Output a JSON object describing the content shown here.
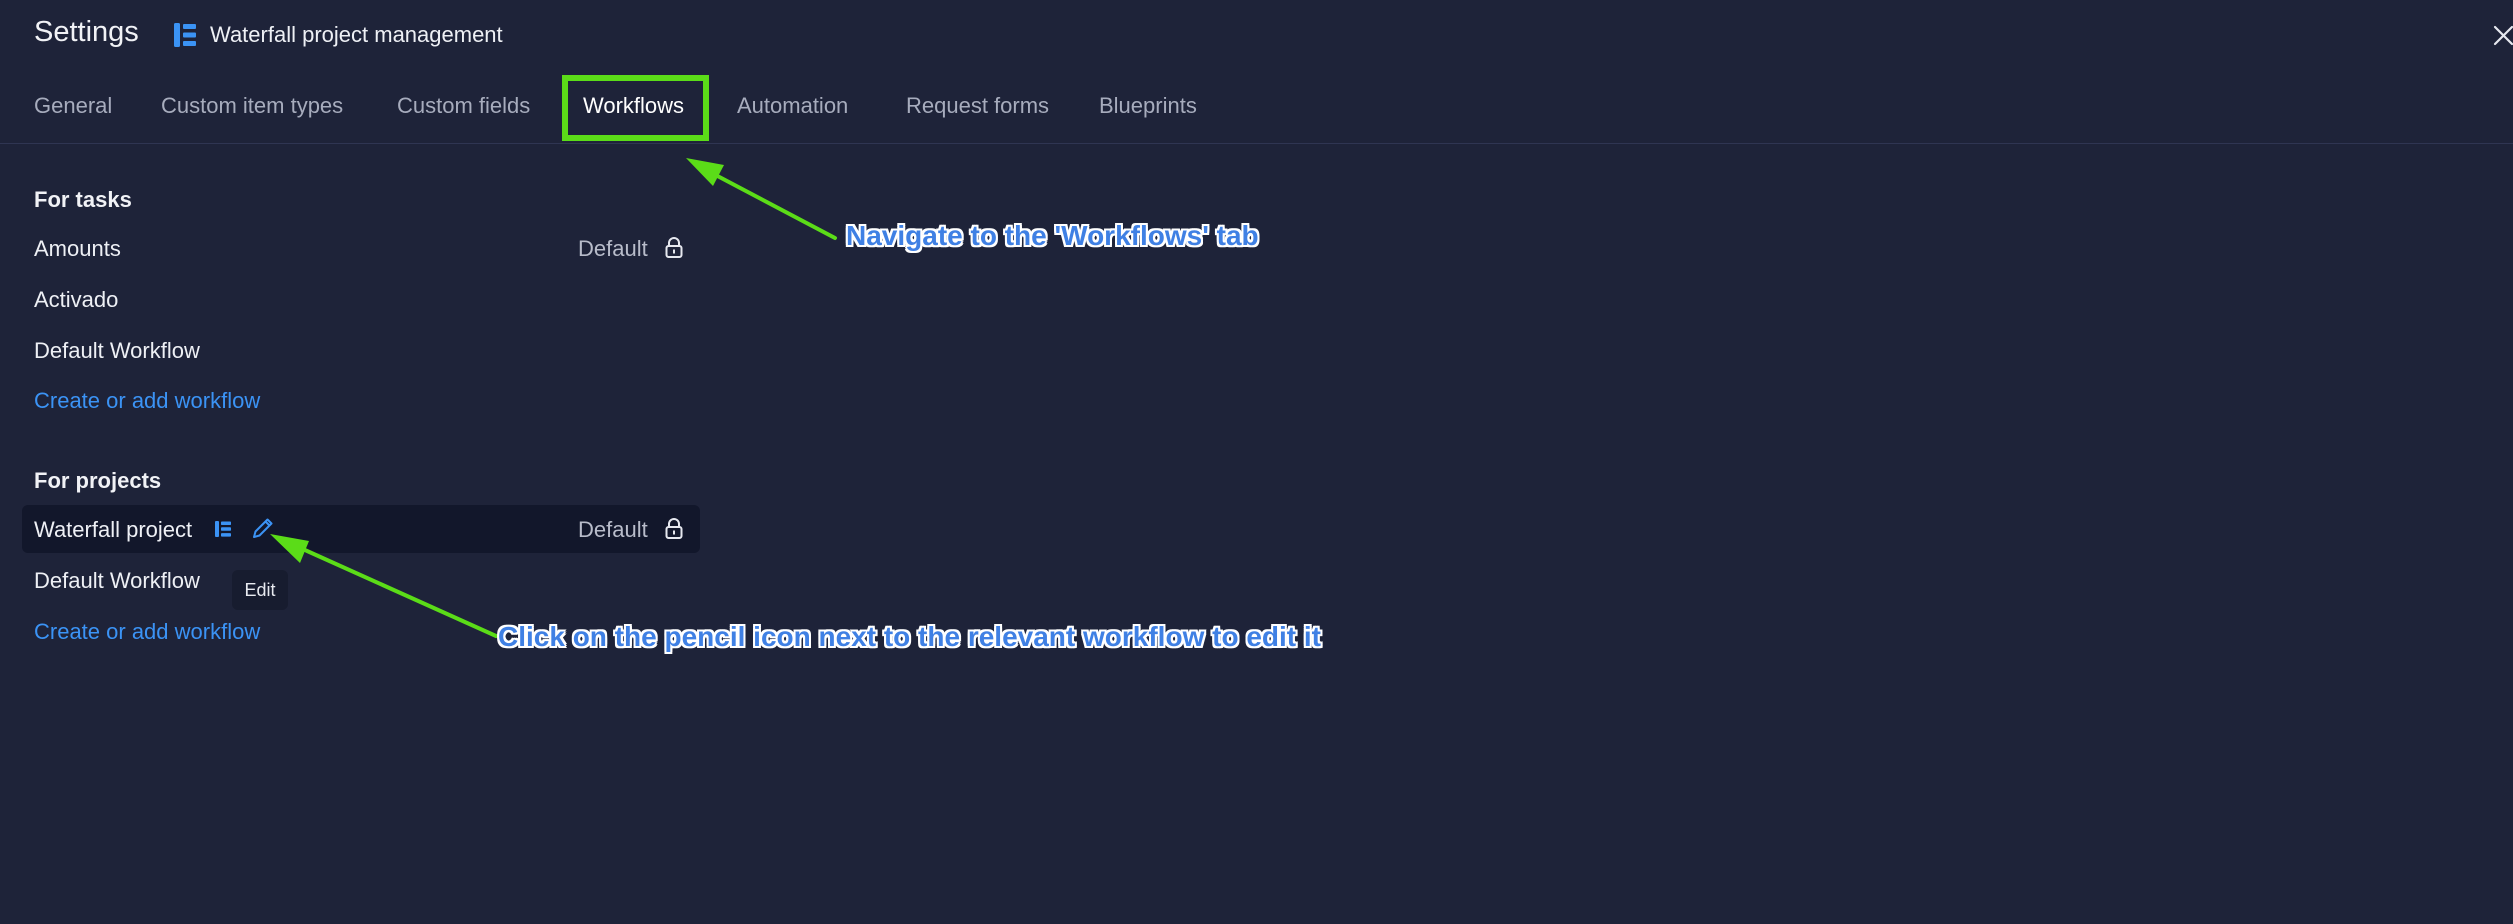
{
  "header": {
    "title": "Settings",
    "project_icon": "list-board-icon",
    "project_name": "Waterfall project management",
    "close_icon": "close-icon"
  },
  "tabs": [
    {
      "label": "General",
      "active": false
    },
    {
      "label": "Custom item types",
      "active": false
    },
    {
      "label": "Custom fields",
      "active": false
    },
    {
      "label": "Workflows",
      "active": true
    },
    {
      "label": "Automation",
      "active": false
    },
    {
      "label": "Request forms",
      "active": false
    },
    {
      "label": "Blueprints",
      "active": false
    }
  ],
  "tasks": {
    "title": "For tasks",
    "workflows": [
      {
        "name": "Amounts",
        "badge": "Default",
        "locked": true
      },
      {
        "name": "Activado"
      },
      {
        "name": "Default Workflow"
      }
    ],
    "create_label": "Create or add workflow"
  },
  "projects": {
    "title": "For projects",
    "workflows": [
      {
        "name": "Waterfall project",
        "badge": "Default",
        "locked": true,
        "hovered": true
      },
      {
        "name": "Default Workflow"
      }
    ],
    "create_label": "Create or add workflow"
  },
  "tooltip": {
    "text": "Edit"
  },
  "annotations": {
    "workflows_tab": "Navigate to the 'Workflows' tab",
    "pencil": "Click on the pencil icon next to the relevant workflow to edit it"
  },
  "colors": {
    "background": "#1e2339",
    "link": "#3b93f5",
    "highlight": "#5bdc18",
    "annotation_text": "#3f80e4",
    "icon_accent": "#3b93f5"
  }
}
